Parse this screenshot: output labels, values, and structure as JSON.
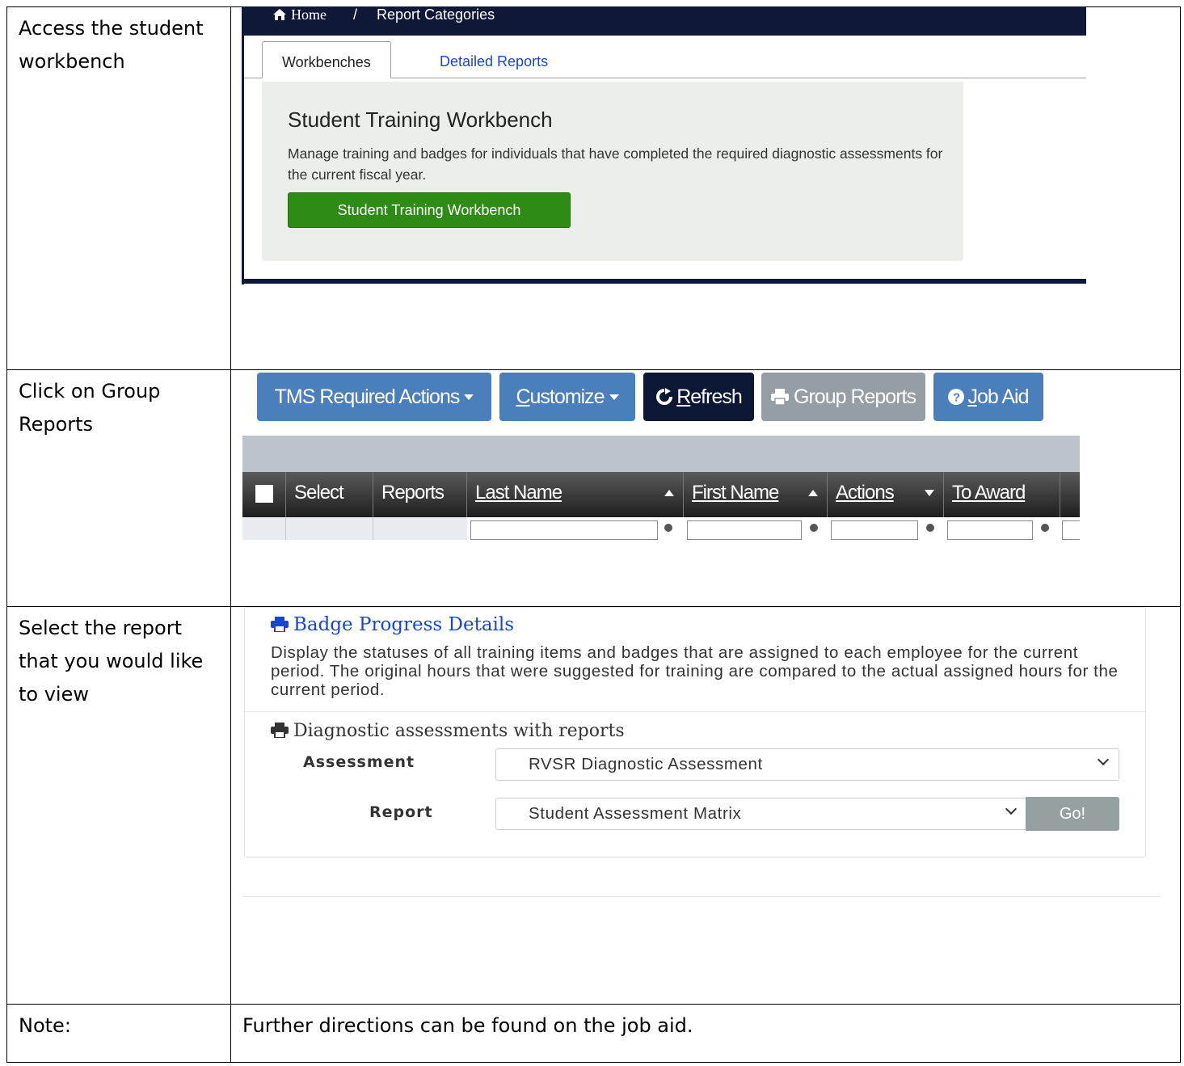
{
  "steps": [
    {
      "instruction": "Access the student workbench"
    },
    {
      "instruction": "Click on Group Reports"
    },
    {
      "instruction": "Select the report that you would like to view"
    }
  ],
  "note": {
    "label": "Note:",
    "text": "Further directions can be found on the job aid."
  },
  "workbench_screen": {
    "breadcrumb": {
      "home": "Home",
      "separator": "/",
      "current": "Report Categories"
    },
    "tabs": [
      "Workbenches",
      "Detailed Reports"
    ],
    "panel_title": "Student Training Workbench",
    "panel_description": "Manage training and badges for individuals that have completed the required diagnostic assessments for the current fiscal year.",
    "button_label": "Student Training Workbench",
    "colors": {
      "nav_bar": "#0f1836",
      "button": "#2e8b16",
      "panel": "#eceeec",
      "tab_link": "#1a44d6"
    }
  },
  "toolbar_screen": {
    "buttons": {
      "tms": "TMS Required Actions",
      "customize_first": "C",
      "customize_rest": "ustomize",
      "refresh_first": "R",
      "refresh_rest": "efresh",
      "group_reports": "Group Reports",
      "job_aid_first": "J",
      "job_aid_rest": "ob Aid"
    },
    "icons": [
      "refresh-icon",
      "printer-icon",
      "question-circle-icon"
    ],
    "columns": [
      "Select",
      "Reports",
      "Last Name",
      "First Name",
      "Actions",
      "To Award"
    ],
    "colors": {
      "primary_button": "#4a7fbc",
      "refresh_button": "#0c1735",
      "disabled_button": "#959da5"
    }
  },
  "report_screen": {
    "badge_title": "Badge Progress Details",
    "badge_description": "Display the statuses of all training items and badges that are assigned to each employee for the current period. The original hours that were suggested for training are compared to the actual assigned hours for the current period.",
    "diagnostic_title": "Diagnostic assessments with reports",
    "assessment_label": "Assessment",
    "assessment_value": "RVSR Diagnostic Assessment",
    "report_label": "Report",
    "report_value": "Student Assessment Matrix",
    "go_label": "Go!",
    "colors": {
      "title_link": "#1a44d6",
      "go_button": "#95a0a0"
    }
  }
}
